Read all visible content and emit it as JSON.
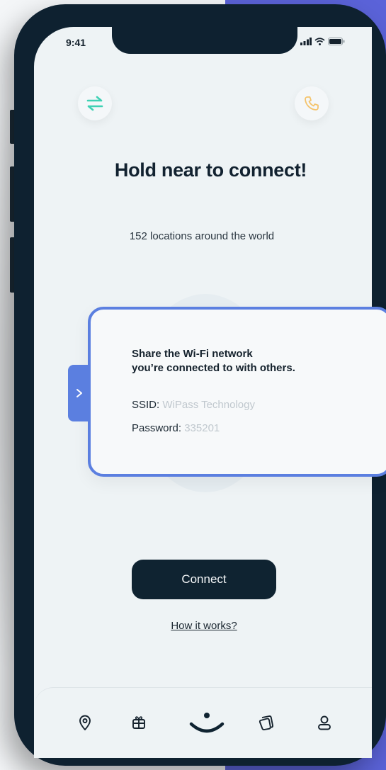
{
  "status_bar": {
    "time": "9:41"
  },
  "header": {
    "left_icon": "transfer-arrows-icon",
    "right_icon": "phone-icon",
    "accent_left": "#3fd1b4",
    "accent_right": "#f4c36b"
  },
  "main": {
    "title": "Hold near to connect!",
    "subtitle": "152 locations around the world"
  },
  "card": {
    "heading_line1": "Share the Wi-Fi network",
    "heading_line2": "you’re connected to with others.",
    "ssid_label": "SSID:",
    "ssid_value": "WiPass Technology",
    "password_label": "Password:",
    "password_value": "335201",
    "accent": "#5b7fe0"
  },
  "actions": {
    "connect_label": "Connect",
    "how_label": "How it works?"
  },
  "tabbar": {
    "items": [
      {
        "icon": "location-pin-icon"
      },
      {
        "icon": "gift-icon"
      },
      {
        "icon": "smile-home-icon"
      },
      {
        "icon": "cards-icon"
      },
      {
        "icon": "profile-icon"
      }
    ]
  }
}
